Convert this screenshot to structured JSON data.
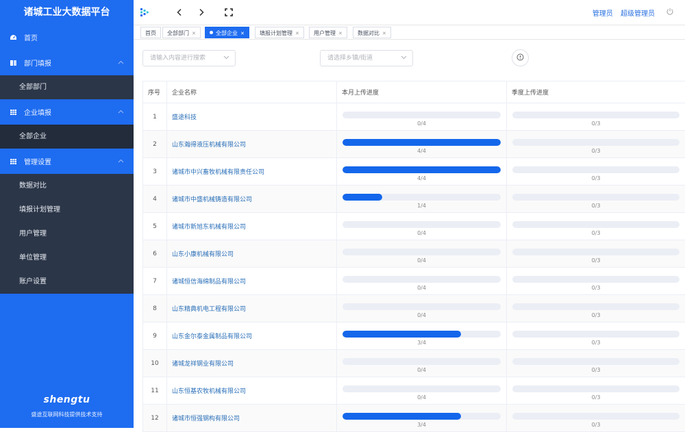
{
  "sidebar": {
    "title": "诸城工业大数据平台",
    "items": [
      {
        "label": "首页"
      },
      {
        "label": "部门填报",
        "children": [
          {
            "label": "全部部门"
          }
        ]
      },
      {
        "label": "企业填报",
        "children": [
          {
            "label": "全部企业"
          }
        ]
      },
      {
        "label": "管理设置",
        "children": [
          {
            "label": "数据对比"
          },
          {
            "label": "填报计划管理"
          },
          {
            "label": "用户管理"
          },
          {
            "label": "单位管理"
          },
          {
            "label": "账户设置"
          }
        ]
      }
    ],
    "footer_logo": "shengtu",
    "footer_text": "盛途互联网科技提供技术支持"
  },
  "topbar": {
    "user_role": "管理员",
    "user_name": "超级管理员"
  },
  "tabs": [
    {
      "label": "首页"
    },
    {
      "label": "全部部门"
    },
    {
      "label": "全部企业"
    },
    {
      "label": "填报计划管理"
    },
    {
      "label": "用户管理"
    },
    {
      "label": "数据对比"
    }
  ],
  "filters": {
    "search_placeholder": "请输入内容进行搜索",
    "town_placeholder": "请选择乡镇/街道"
  },
  "table": {
    "columns": [
      "序号",
      "企业名称",
      "本月上传进度",
      "季度上传进度"
    ],
    "rows": [
      {
        "idx": "1",
        "name": "盛途科技",
        "month": "0/4",
        "month_pct": 0,
        "quarter": "0/3",
        "quarter_pct": 0
      },
      {
        "idx": "2",
        "name": "山东瀚得液压机械有限公司",
        "month": "4/4",
        "month_pct": 100,
        "quarter": "0/3",
        "quarter_pct": 0
      },
      {
        "idx": "3",
        "name": "诸城市中兴畜牧机械有限责任公司",
        "month": "4/4",
        "month_pct": 100,
        "quarter": "0/3",
        "quarter_pct": 0
      },
      {
        "idx": "4",
        "name": "诸城市中盛机械铸造有限公司",
        "month": "1/4",
        "month_pct": 25,
        "quarter": "0/3",
        "quarter_pct": 0
      },
      {
        "idx": "5",
        "name": "诸城市新旭东机械有限公司",
        "month": "0/4",
        "month_pct": 0,
        "quarter": "0/3",
        "quarter_pct": 0
      },
      {
        "idx": "6",
        "name": "山东小康机械有限公司",
        "month": "0/4",
        "month_pct": 0,
        "quarter": "0/3",
        "quarter_pct": 0
      },
      {
        "idx": "7",
        "name": "诸城恒信海绵制品有限公司",
        "month": "0/4",
        "month_pct": 0,
        "quarter": "0/3",
        "quarter_pct": 0
      },
      {
        "idx": "8",
        "name": "山东精典机电工程有限公司",
        "month": "0/4",
        "month_pct": 0,
        "quarter": "0/3",
        "quarter_pct": 0
      },
      {
        "idx": "9",
        "name": "山东金尔泰金属制品有限公司",
        "month": "3/4",
        "month_pct": 75,
        "quarter": "0/3",
        "quarter_pct": 0
      },
      {
        "idx": "10",
        "name": "诸城龙祥钢业有限公司",
        "month": "0/4",
        "month_pct": 0,
        "quarter": "0/3",
        "quarter_pct": 0
      },
      {
        "idx": "11",
        "name": "山东恒基农牧机械有限公司",
        "month": "0/4",
        "month_pct": 0,
        "quarter": "0/3",
        "quarter_pct": 0
      },
      {
        "idx": "12",
        "name": "诸城市恒强钢构有限公司",
        "month": "3/4",
        "month_pct": 75,
        "quarter": "0/3",
        "quarter_pct": 0
      }
    ]
  }
}
